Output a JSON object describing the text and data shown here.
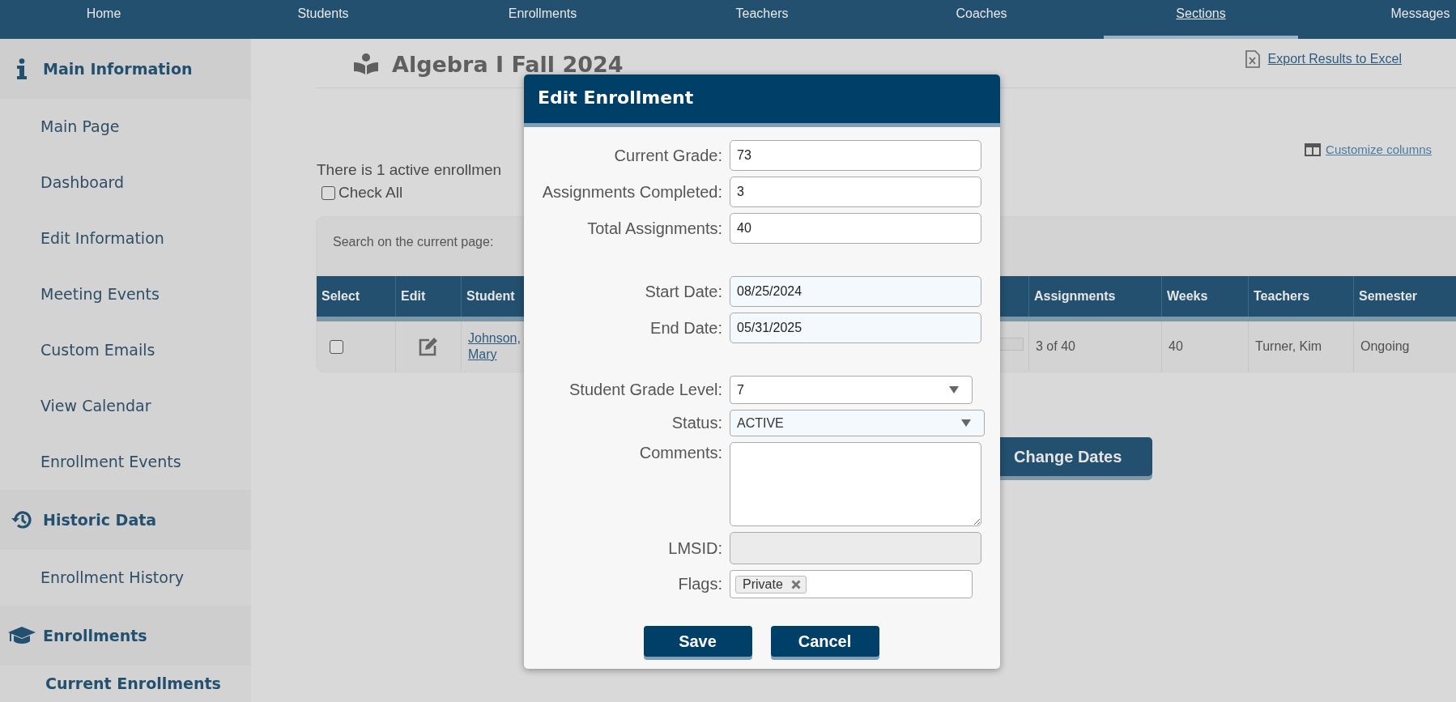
{
  "nav": [
    {
      "label": "Home",
      "selected": false
    },
    {
      "label": "Students",
      "selected": false
    },
    {
      "label": "Enrollments",
      "selected": false
    },
    {
      "label": "Teachers",
      "selected": false
    },
    {
      "label": "Coaches",
      "selected": false
    },
    {
      "label": "Sections",
      "selected": true
    },
    {
      "label": "Messages",
      "selected": false
    }
  ],
  "sidebar": {
    "sections": [
      {
        "title": "Main Information",
        "items": [
          {
            "label": "Main Page",
            "selected": false
          },
          {
            "label": "Dashboard",
            "selected": false
          },
          {
            "label": "Edit Information",
            "selected": false
          },
          {
            "label": "Meeting Events",
            "selected": false
          },
          {
            "label": "Custom Emails",
            "selected": false
          },
          {
            "label": "View Calendar",
            "selected": false
          },
          {
            "label": "Enrollment Events",
            "selected": false
          }
        ]
      },
      {
        "title": "Historic Data",
        "items": [
          {
            "label": "Enrollment History",
            "selected": false
          }
        ]
      },
      {
        "title": "Enrollments",
        "items": [
          {
            "label": "Current Enrollments",
            "selected": true
          }
        ]
      }
    ]
  },
  "page": {
    "title": "Algebra I Fall 2024",
    "export_link": "Export Results to Excel",
    "customize_link": "Customize columns",
    "summary": "There is 1 active enrollmen",
    "check_all": {
      "label": "Check All",
      "checked": false
    },
    "search_label": "Search on the current page:"
  },
  "table": {
    "columns": [
      "Select",
      "Edit",
      "Student",
      "Assignments",
      "Weeks",
      "Teachers",
      "Semester"
    ],
    "rows": [
      {
        "selected": false,
        "student": "Johnson, Mary",
        "assignments": "3 of 40",
        "weeks": "40",
        "teachers": "Turner, Kim",
        "semester": "Ongoing"
      }
    ]
  },
  "change_dates_button": "Change Dates",
  "dialog": {
    "title": "Edit Enrollment",
    "field_groups": [
      [
        {
          "kind": "text",
          "label": "Current Grade:",
          "value": "73"
        },
        {
          "kind": "text",
          "label": "Assignments Completed:",
          "value": "3"
        },
        {
          "kind": "text",
          "label": "Total Assignments:",
          "value": "40"
        }
      ],
      [
        {
          "kind": "date",
          "label": "Start Date:",
          "value": "08/25/2024"
        },
        {
          "kind": "date",
          "label": "End Date:",
          "value": "05/31/2025"
        }
      ],
      [
        {
          "kind": "select",
          "label": "Student Grade Level:",
          "value": "7"
        },
        {
          "kind": "status",
          "label": "Status:",
          "value": "ACTIVE"
        },
        {
          "kind": "textarea",
          "label": "Comments:"
        },
        {
          "kind": "disabled",
          "label": "LMSID:"
        },
        {
          "kind": "tags",
          "label": "Flags:",
          "tags": [
            "Private"
          ]
        }
      ]
    ],
    "buttons": [
      "Save",
      "Cancel"
    ]
  }
}
